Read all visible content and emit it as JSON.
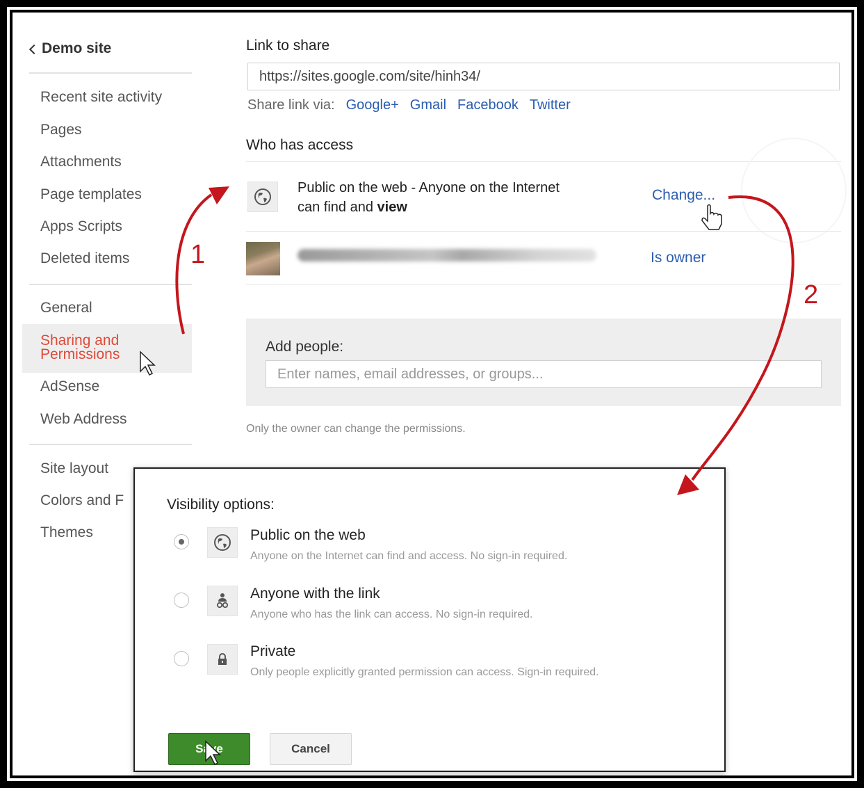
{
  "sidebar": {
    "back_label": "Demo site",
    "group1": [
      "Recent site activity",
      "Pages",
      "Attachments",
      "Page templates",
      "Apps Scripts",
      "Deleted items"
    ],
    "group2": [
      "General",
      "Sharing and Permissions",
      "AdSense",
      "Web Address"
    ],
    "group3": [
      "Site layout",
      "Colors and F",
      "Themes"
    ]
  },
  "link_section": {
    "heading": "Link to share",
    "url": "https://sites.google.com/site/hinh34/",
    "share_via_label": "Share link via:",
    "share_links": [
      "Google+",
      "Gmail",
      "Facebook",
      "Twitter"
    ]
  },
  "access": {
    "heading": "Who has access",
    "public_line1": "Public on the web - Anyone on the Internet",
    "public_line2_prefix": "can find and ",
    "public_line2_bold": "view",
    "change_link": "Change...",
    "owner_label": "Is owner"
  },
  "add_people": {
    "label": "Add people:",
    "placeholder": "Enter names, email addresses, or groups..."
  },
  "owner_note": "Only the owner can change the permissions.",
  "dialog": {
    "title": "Visibility options:",
    "options": [
      {
        "title": "Public on the web",
        "desc": "Anyone on the Internet can find and access. No sign-in required.",
        "selected": true,
        "icon": "globe-icon"
      },
      {
        "title": "Anyone with the link",
        "desc": "Anyone who has the link can access. No sign-in required.",
        "selected": false,
        "icon": "person-link-icon"
      },
      {
        "title": "Private",
        "desc": "Only people explicitly granted permission can access. Sign-in required.",
        "selected": false,
        "icon": "lock-icon"
      }
    ],
    "save_label": "Save",
    "cancel_label": "Cancel"
  },
  "annotation_numbers": [
    "1",
    "2"
  ],
  "colors": {
    "accent_red": "#dd4b39",
    "link_blue": "#2a5db0",
    "save_green": "#3d8b2a",
    "arrow_red": "#c4161c"
  }
}
